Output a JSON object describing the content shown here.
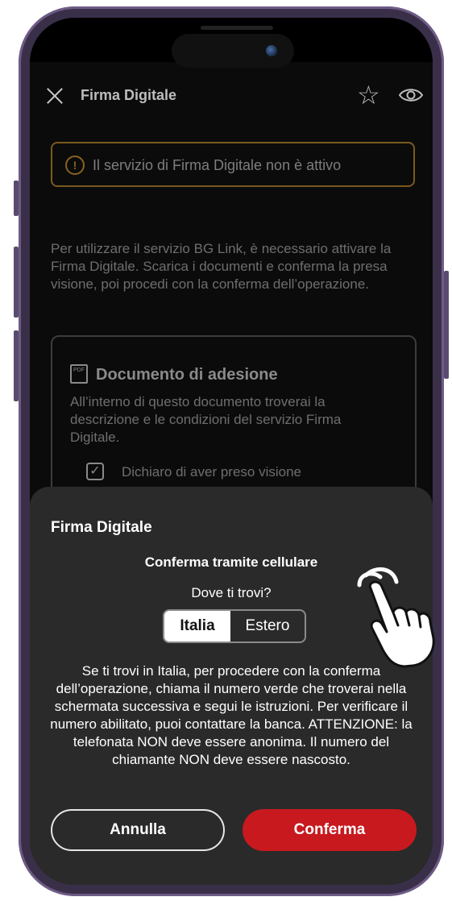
{
  "app_bar": {
    "title": "Firma Digitale",
    "close_icon": "close-icon",
    "favorite_icon": "star-icon",
    "view_icon": "eye-icon"
  },
  "warning": {
    "icon": "warning-icon",
    "text": "Il servizio di Firma Digitale non è attivo"
  },
  "intro_text": "Per utilizzare il servizio BG Link, è necessario attivare la Firma Digitale. Scarica i documenti e conferma la presa visione, poi procedi con la conferma dell’operazione.",
  "document_card": {
    "icon": "pdf-icon",
    "title": "Documento di adesione",
    "description": "All’interno di questo documento troverai la descrizione e le condizioni del servizio Firma Digitale.",
    "checkbox_label": "Dichiaro di aver preso visione",
    "checkbox_checked": true
  },
  "sheet": {
    "title": "Firma Digitale",
    "subtitle": "Conferma tramite cellulare",
    "question": "Dove ti trovi?",
    "segment_options": [
      "Italia",
      "Estero"
    ],
    "segment_selected": "Italia",
    "body": "Se ti trovi in Italia, per procedere con la conferma dell’operazione, chiama il numero verde che troverai nella schermata successiva e segui le istruzioni. Per verificare il numero abilitato, puoi contattare la banca. ATTENZIONE: la telefonata NON deve essere anonima. Il numero del chiamante NON deve essere nascosto.",
    "cancel_label": "Annulla",
    "confirm_label": "Conferma"
  },
  "colors": {
    "confirm_button": "#c8191e",
    "warning_border": "#7a5a1e",
    "sheet_background": "#2a2a2a"
  },
  "overlay_icon": "pointing-hand-icon"
}
